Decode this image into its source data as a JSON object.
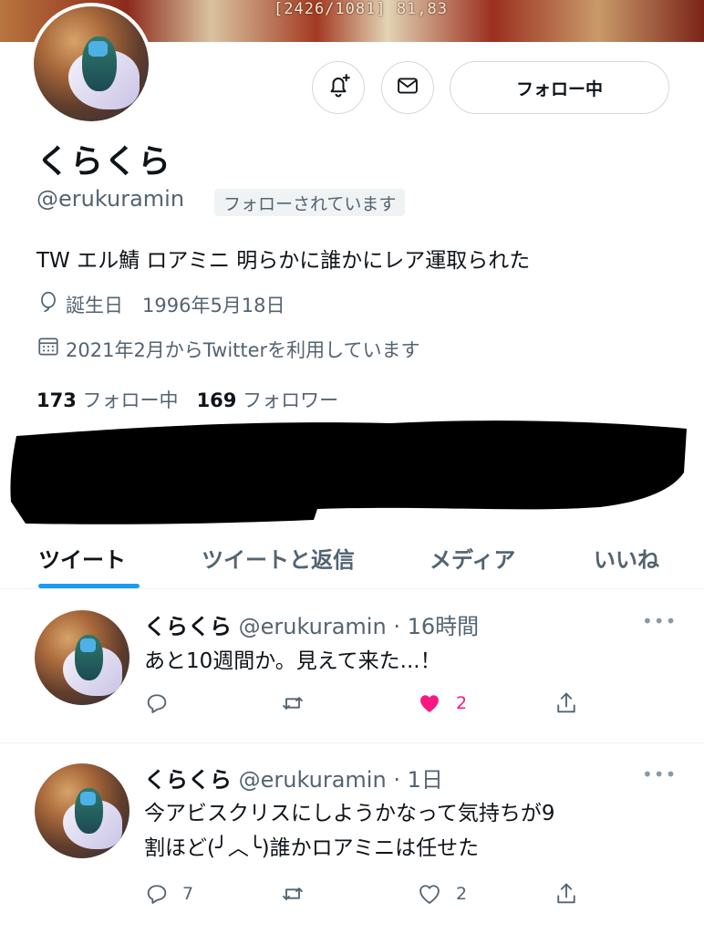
{
  "banner": {
    "overlay_text": "[2426/1081] 81,83"
  },
  "profile": {
    "display_name": "くらくら",
    "handle": "@erukuramin",
    "follows_you": "フォローされています",
    "bio": "TW エル鯖 ロアミニ 明らかに誰かにレア運取られた",
    "birthday": "誕生日　1996年5月18日",
    "joined": "2021年2月からTwitterを利用しています",
    "following_count": "173",
    "following_label": "フォロー中",
    "followers_count": "169",
    "followers_label": "フォロワー"
  },
  "actions": {
    "follow_button": "フォロー中",
    "notify_icon": "bell-plus-icon",
    "message_icon": "envelope-icon"
  },
  "tabs": [
    {
      "label": "ツイート",
      "active": true
    },
    {
      "label": "ツイートと返信",
      "active": false
    },
    {
      "label": "メディア",
      "active": false
    },
    {
      "label": "いいね",
      "active": false
    }
  ],
  "tweets": [
    {
      "name": "くらくら",
      "meta": "@erukuramin · 16時間",
      "text_lines": [
        "あと10週間か。見えて来た...！"
      ],
      "reply_count": "",
      "retweet_count": "",
      "like_count": "2",
      "liked": true
    },
    {
      "name": "くらくら",
      "meta": "@erukuramin · 1日",
      "text_lines": [
        "今アビスクリスにしようかなって気持ちが9",
        "割ほど(╯︿╰)誰かロアミニは任せた"
      ],
      "reply_count": "7",
      "retweet_count": "",
      "like_count": "2",
      "liked": false
    }
  ],
  "colors": {
    "accent": "#1d9bf0",
    "like": "#f91880",
    "secondary_text": "#536471"
  }
}
